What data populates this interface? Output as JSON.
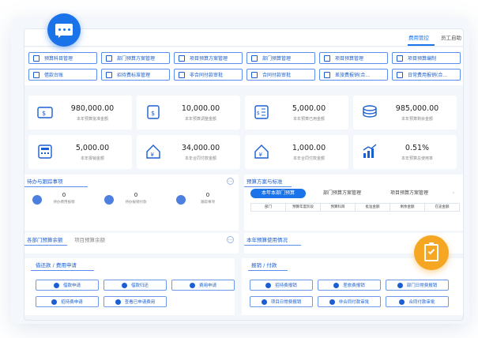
{
  "topbar": {
    "tabs": [
      "费用管控",
      "员工自助"
    ]
  },
  "quick_buttons": [
    "预算科目管理",
    "部门预算方案管理",
    "项目预算方案管理",
    "部门预算管理",
    "项目预算管理",
    "项目预算编制",
    "借款台账",
    "招待费标准管理",
    "非合同付款审批",
    "合同付款审批",
    "差旅费报销(合...",
    "日常费用报销(合..."
  ],
  "stats": [
    {
      "value": "980,000.00",
      "label": "本年预算批准金额"
    },
    {
      "value": "10,000.00",
      "label": "本年预算调整金额"
    },
    {
      "value": "5,000.00",
      "label": "本年预算已用金额"
    },
    {
      "value": "985,000.00",
      "label": "本年预算剩余金额"
    },
    {
      "value": "5,000.00",
      "label": "本年报销金额"
    },
    {
      "value": "34,000.00",
      "label": "本年合同付款金额"
    },
    {
      "value": "1,000.00",
      "label": "本年合同付款金额"
    },
    {
      "value": "0.51%",
      "label": "本年预算总使用率"
    }
  ],
  "todo": {
    "title": "待办与跟踪事项",
    "items": [
      {
        "count": "0",
        "label": "待办费用报销"
      },
      {
        "count": "0",
        "label": "待办报销付款"
      },
      {
        "count": "0",
        "label": "跟踪事项"
      }
    ]
  },
  "budget_plan": {
    "title": "预算方案与标准",
    "tabs": [
      "本年本部门预算",
      "部门预算方案管理",
      "项目预算方案管理"
    ],
    "columns": [
      "部门",
      "预算年度阶段",
      "预算科目",
      "批准金额",
      "剩余金额",
      "在途金额"
    ]
  },
  "dept_budget": {
    "tabs": [
      "各部门预算余额",
      "项目预算余额"
    ]
  },
  "budget_usage": {
    "title": "本年预算使用情况"
  },
  "loan": {
    "title": "借还款 / 费用申请",
    "buttons": [
      "借款申请",
      "借款归还",
      "费用申请",
      "招待费申请",
      "查看已申请费用"
    ]
  },
  "reimburse": {
    "title": "报销 / 付款",
    "buttons": [
      "招待费报销",
      "差旅费报销",
      "部门日常费报销",
      "项目日常费报销",
      "非合同付款审批",
      "合同付款审批"
    ]
  },
  "icons": {
    "chat": "chat-bubble-icon",
    "check": "clipboard-check-icon"
  },
  "colors": {
    "primary": "#1a73e8",
    "accent": "#f5a623"
  }
}
